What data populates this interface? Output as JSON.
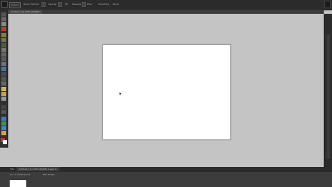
{
  "menu": {
    "file_label": "Arquivo",
    "brush_label": "Brush:",
    "brush_value": "Normal",
    "opacity_label": "Opacity:",
    "fill_label": "Fill:",
    "pressure_label": "Pressure",
    "flow_label": "Flow",
    "smoothing_label": "Smoothing",
    "brush_tip_label": "Brush"
  },
  "document": {
    "tab_title": "Untitled-1 @ 100% (RGB/8)",
    "zoom": "100%",
    "color_mode": "RGB/8"
  },
  "bottom": {
    "tab1": "Mini",
    "tab2": "Untitled-1 @ 100% (RGB/8) (Layer 1)",
    "status_left": "Doc: 1.37M/0 bytes",
    "status_mid": "Mini Bridge"
  },
  "colors": {
    "chrome_dark": "#2b2b2b",
    "canvas_bg": "#c4c4c4",
    "document_bg": "#ffffff",
    "foreground_color": "#c0392b",
    "background_color": "#ffffff"
  },
  "tools": [
    "move-icon",
    "marquee-icon",
    "lasso-icon",
    "quick-select-icon",
    "crop-icon",
    "eyedropper-icon",
    "healing-icon",
    "brush-icon",
    "clone-stamp-icon",
    "history-brush-icon",
    "eraser-icon",
    "gradient-icon",
    "blur-icon",
    "dodge-icon",
    "pen-icon",
    "type-icon",
    "path-select-icon",
    "shape-icon",
    "hand-icon",
    "zoom-icon"
  ]
}
